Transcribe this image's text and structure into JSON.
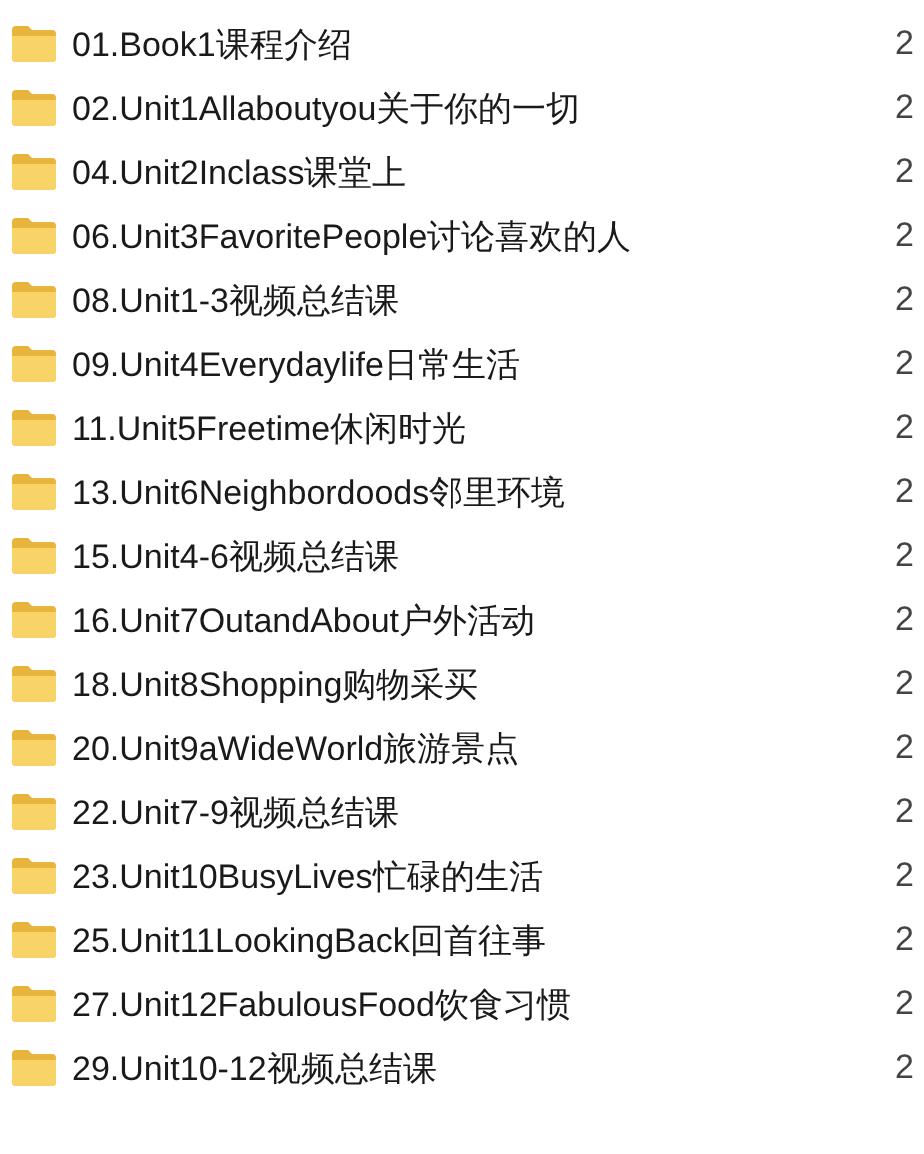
{
  "files": [
    {
      "name": "01.Book1课程介绍",
      "date": "2"
    },
    {
      "name": "02.Unit1Allaboutyou关于你的一切",
      "date": "2"
    },
    {
      "name": "04.Unit2Inclass课堂上",
      "date": "2"
    },
    {
      "name": "06.Unit3FavoritePeople讨论喜欢的人",
      "date": "2"
    },
    {
      "name": "08.Unit1-3视频总结课",
      "date": "2"
    },
    {
      "name": "09.Unit4Everydaylife日常生活",
      "date": "2"
    },
    {
      "name": "11.Unit5Freetime休闲时光",
      "date": "2"
    },
    {
      "name": "13.Unit6Neighbordoods邻里环境",
      "date": "2"
    },
    {
      "name": "15.Unit4-6视频总结课",
      "date": "2"
    },
    {
      "name": "16.Unit7OutandAbout户外活动",
      "date": "2"
    },
    {
      "name": "18.Unit8Shopping购物采买",
      "date": "2"
    },
    {
      "name": "20.Unit9aWideWorld旅游景点",
      "date": "2"
    },
    {
      "name": "22.Unit7-9视频总结课",
      "date": "2"
    },
    {
      "name": "23.Unit10BusyLives忙碌的生活",
      "date": "2"
    },
    {
      "name": "25.Unit11LookingBack回首往事",
      "date": "2"
    },
    {
      "name": "27.Unit12FabulousFood饮食习惯",
      "date": "2"
    },
    {
      "name": "29.Unit10-12视频总结课",
      "date": "2"
    }
  ]
}
